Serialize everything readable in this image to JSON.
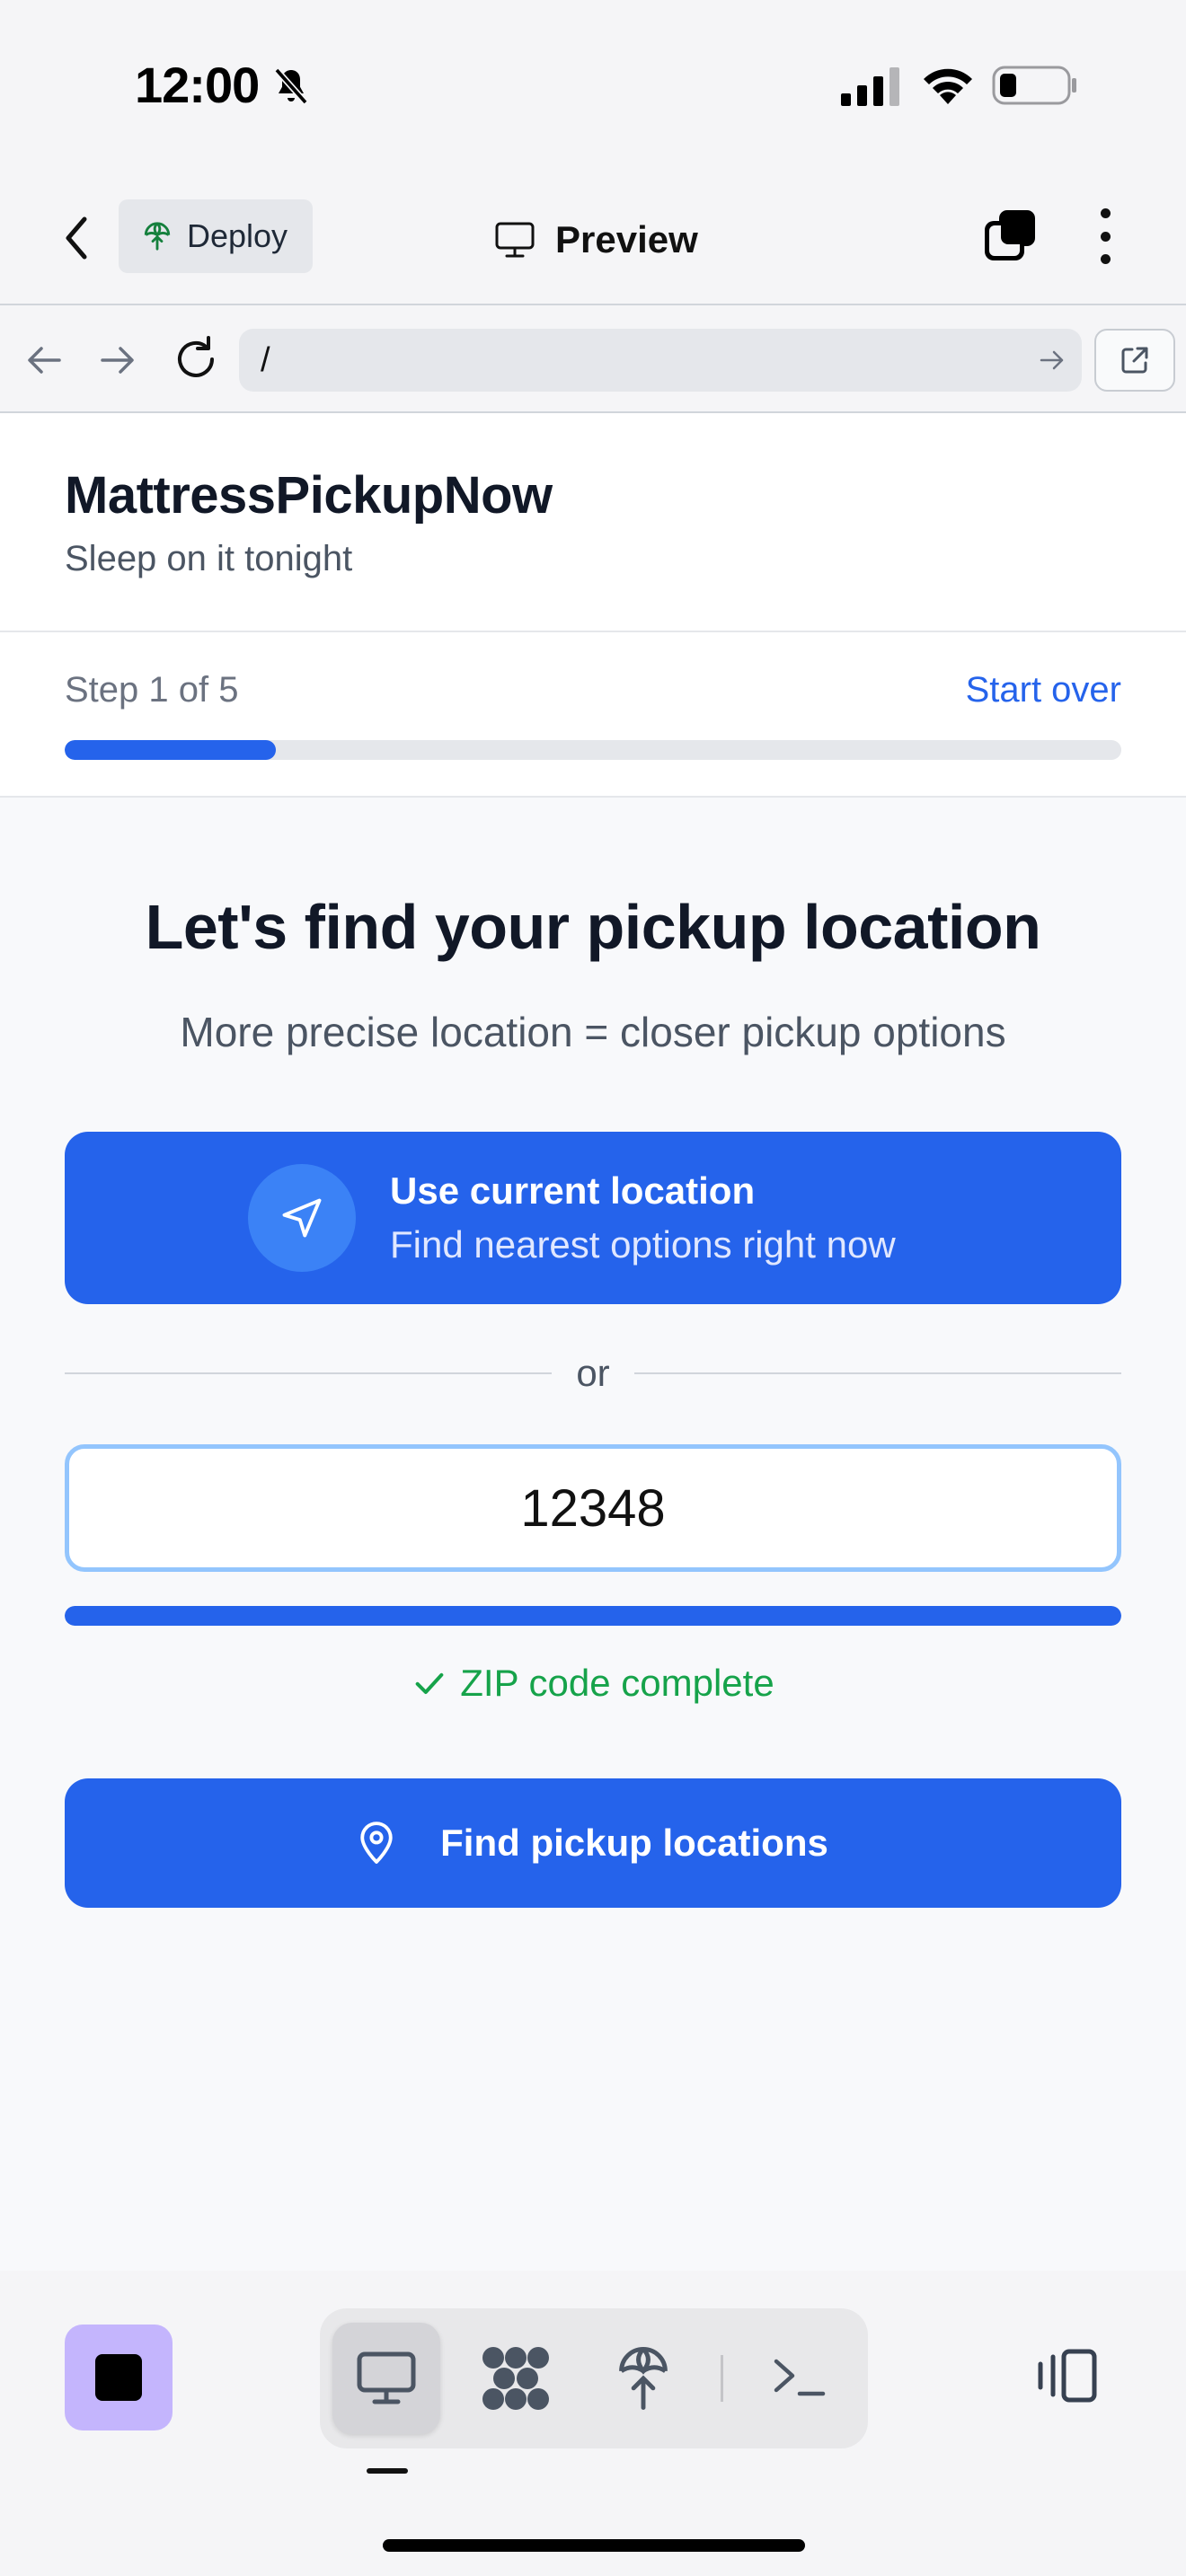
{
  "status_bar": {
    "time": "12:00"
  },
  "app_bar": {
    "deploy_label": "Deploy",
    "preview_label": "Preview"
  },
  "browser": {
    "url": "/"
  },
  "site": {
    "brand_name": "MattressPickupNow",
    "tagline": "Sleep on it tonight"
  },
  "progress": {
    "step_label": "Step 1 of 5",
    "start_over_label": "Start over",
    "fraction": 0.2
  },
  "main": {
    "title": "Let's find your pickup location",
    "subtitle": "More precise location = closer pickup options",
    "use_location": {
      "title": "Use current location",
      "subtitle": "Find nearest options right now"
    },
    "divider_text": "or",
    "zip": {
      "value": "12348",
      "progress_fraction": 1.0,
      "status": "ZIP code complete"
    },
    "find_button_label": "Find pickup locations"
  },
  "colors": {
    "primary": "#2563eb",
    "success": "#16a34a",
    "stop_button": "#c4b5fd"
  },
  "bottom_toolbar": {
    "icons": [
      "stop-icon",
      "monitor-icon",
      "apps-icon",
      "deploy-icon",
      "terminal-icon",
      "panel-icon"
    ]
  }
}
